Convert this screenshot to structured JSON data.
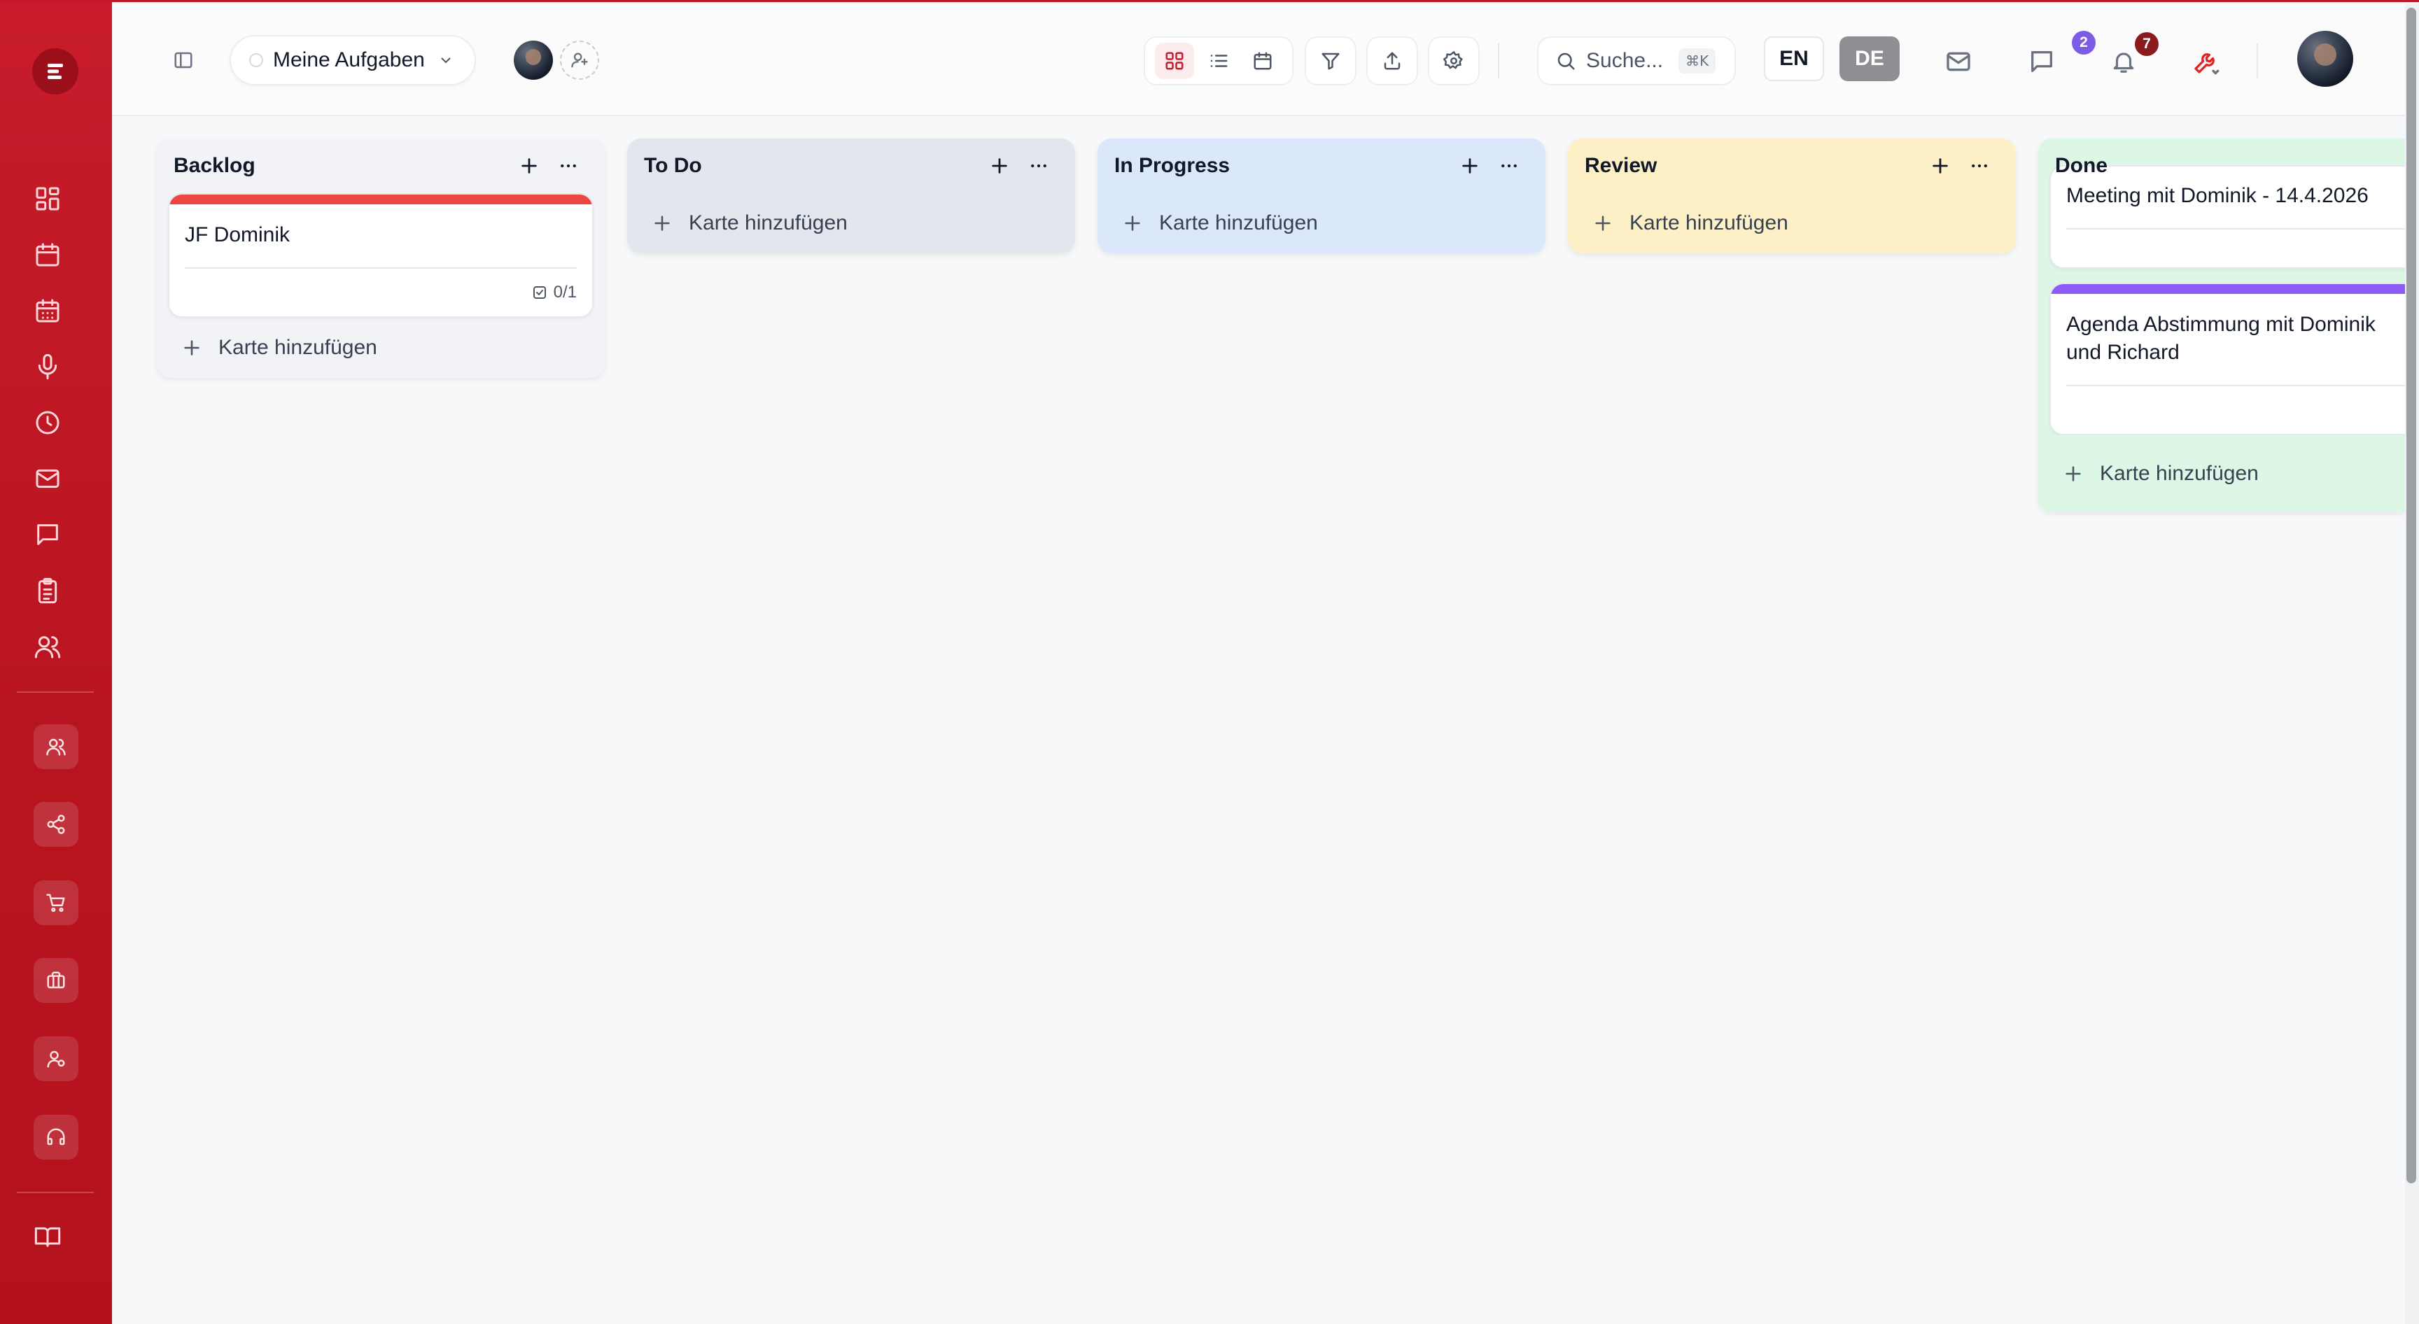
{
  "app": {
    "accent": "#c81c2b"
  },
  "sidebar": {
    "logo_icon": "app-logo",
    "nav": [
      "dashboard-icon",
      "calendar-icon",
      "calendar-grid-icon",
      "microphone-icon",
      "clock-icon",
      "mail-icon",
      "chat-icon",
      "clipboard-icon",
      "users-icon"
    ],
    "modules": [
      "team-icon",
      "share-icon",
      "cart-icon",
      "briefcase-icon",
      "user-settings-icon",
      "headset-icon"
    ],
    "footer": "book-icon"
  },
  "toolbar": {
    "view_dropdown": "Meine Aufgaben",
    "search_placeholder": "Suche...",
    "search_shortcut": "⌘K",
    "lang_en": "EN",
    "lang_de": "DE",
    "mail_badge": "2",
    "notification_badge": "7",
    "mail_badge_color": "#7c5ce6",
    "notification_badge_color": "#8b1a1f"
  },
  "board": {
    "add_card_label": "Karte hinzufügen",
    "columns": [
      {
        "title": "Backlog",
        "color": "#f1f3f7",
        "cards": [
          {
            "title": "JF Dominik",
            "stripe": "#ef4444",
            "checklist": "0/1"
          }
        ]
      },
      {
        "title": "To Do",
        "color": "#e3e7ed",
        "cards": []
      },
      {
        "title": "In Progress",
        "color": "#dbe8fb",
        "cards": []
      },
      {
        "title": "Review",
        "color": "#fdf0c7",
        "cards": []
      },
      {
        "title": "Done",
        "color": "#dcf7e5",
        "cards": [
          {
            "title": "Meeting mit Dominik - 14.4.2026",
            "stripe": ""
          },
          {
            "title": "Agenda Abstimmung mit Dominik und Richard",
            "stripe": "#8b5cf6"
          }
        ]
      }
    ]
  }
}
